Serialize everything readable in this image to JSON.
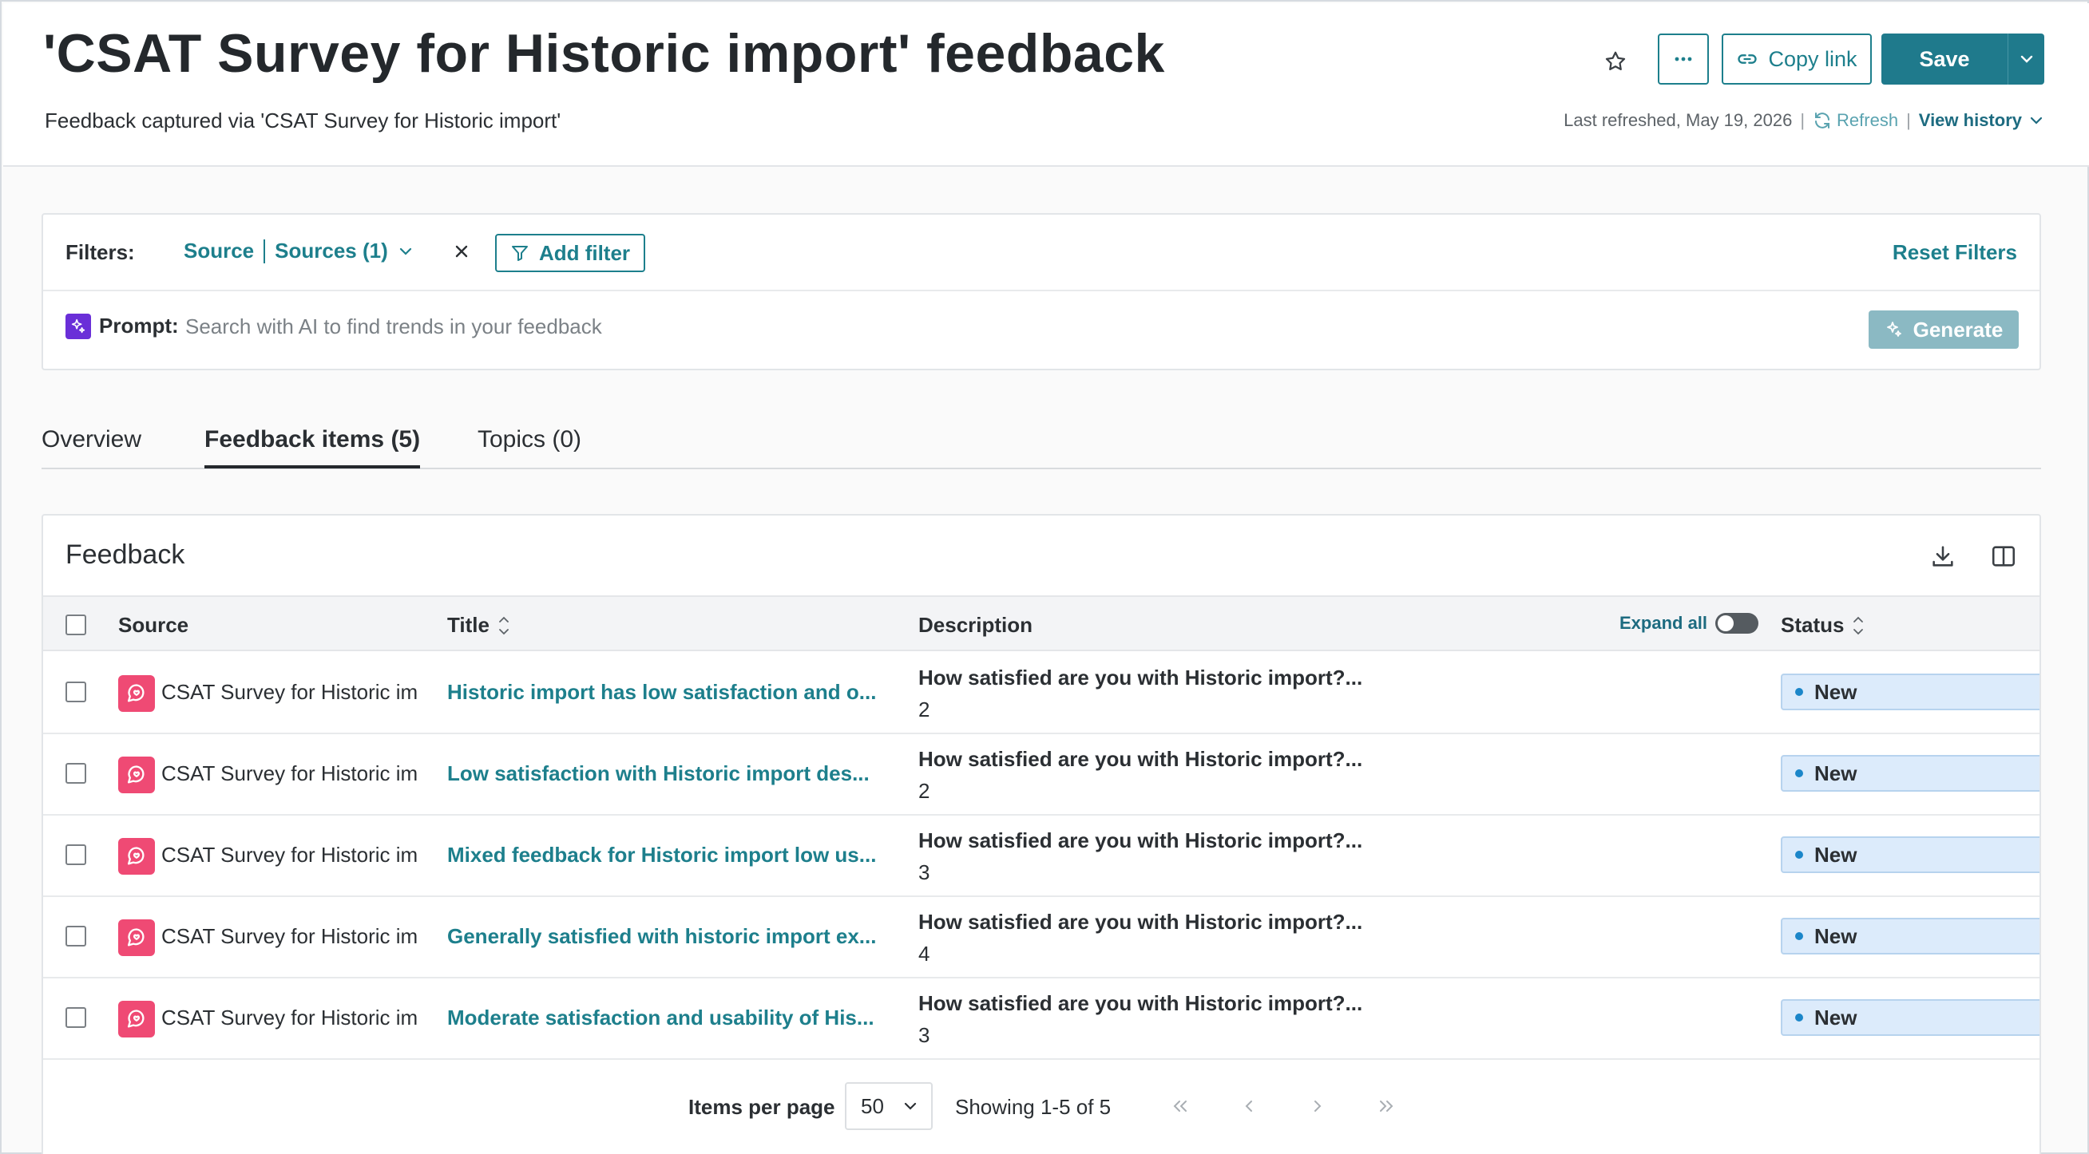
{
  "header": {
    "title": "'CSAT Survey for Historic import' feedback",
    "subtitle": "Feedback captured via 'CSAT Survey for Historic import'",
    "copy_link_label": "Copy link",
    "save_label": "Save",
    "last_refreshed": "Last refreshed, May 19, 2026",
    "refresh_label": "Refresh",
    "view_history_label": "View history"
  },
  "filters": {
    "label": "Filters:",
    "chip_field": "Source",
    "chip_value": "Sources (1)",
    "add_filter_label": "Add filter",
    "reset_label": "Reset Filters"
  },
  "prompt": {
    "label": "Prompt:",
    "placeholder": "Search with AI to find trends in your feedback",
    "generate_label": "Generate"
  },
  "tabs": [
    {
      "label": "Overview"
    },
    {
      "label": "Feedback items (5)"
    },
    {
      "label": "Topics (0)"
    }
  ],
  "feedback": {
    "card_title": "Feedback",
    "columns": {
      "source": "Source",
      "title": "Title",
      "description": "Description",
      "expand_all": "Expand all",
      "status": "Status"
    },
    "rows": [
      {
        "source": "CSAT Survey for Historic im",
        "title": "Historic import has low satisfaction and o...",
        "question": "How satisfied are you with Historic import?...",
        "answer": "2",
        "status": "New"
      },
      {
        "source": "CSAT Survey for Historic im",
        "title": "Low satisfaction with Historic import des...",
        "question": "How satisfied are you with Historic import?...",
        "answer": "2",
        "status": "New"
      },
      {
        "source": "CSAT Survey for Historic im",
        "title": "Mixed feedback for Historic import low us...",
        "question": "How satisfied are you with Historic import?...",
        "answer": "3",
        "status": "New"
      },
      {
        "source": "CSAT Survey for Historic im",
        "title": "Generally satisfied with historic import ex...",
        "question": "How satisfied are you with Historic import?...",
        "answer": "4",
        "status": "New"
      },
      {
        "source": "CSAT Survey for Historic im",
        "title": "Moderate satisfaction and usability of His...",
        "question": "How satisfied are you with Historic import?...",
        "answer": "3",
        "status": "New"
      }
    ]
  },
  "pagination": {
    "items_per_page_label": "Items per page",
    "items_per_page": "50",
    "showing": "Showing 1-5 of 5"
  },
  "colors": {
    "accent": "#1d7f8c",
    "save_button": "#1f7a8c",
    "source_icon": "#ef4a74",
    "ai_icon": "#6a2fd8",
    "status_badge": "#dcebfb"
  }
}
